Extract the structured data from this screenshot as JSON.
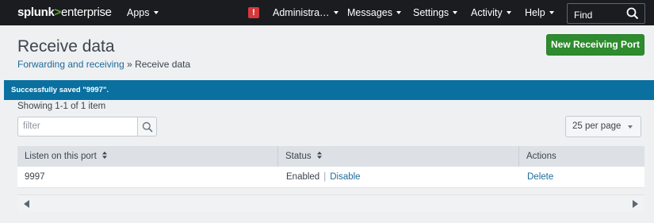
{
  "nav": {
    "logo_splunk": "splunk",
    "logo_gt": ">",
    "logo_enterprise": "enterprise",
    "apps": "Apps",
    "administrator": "Administra…",
    "messages": "Messages",
    "settings": "Settings",
    "activity": "Activity",
    "help": "Help",
    "alert_glyph": "!",
    "find_placeholder": "Find"
  },
  "header": {
    "title": "Receive data",
    "breadcrumb_link": "Forwarding and receiving",
    "breadcrumb_sep": " » ",
    "breadcrumb_current": "Receive data",
    "new_button": "New Receiving Port"
  },
  "banner": {
    "message": "Successfully saved \"9997\"."
  },
  "list": {
    "showing": "Showing 1-1 of 1 item",
    "filter_placeholder": "filter",
    "per_page": "25 per page"
  },
  "table": {
    "headers": [
      "Listen on this port",
      "Status",
      "Actions"
    ],
    "rows": [
      {
        "port": "9997",
        "status": "Enabled",
        "toggle": "Disable",
        "action": "Delete"
      }
    ]
  },
  "colors": {
    "nav_bg": "#1a1c20",
    "banner_bg": "#0a70a0",
    "primary_button": "#2e8b2e",
    "link": "#1e6b9a",
    "alert": "#d6383b"
  }
}
